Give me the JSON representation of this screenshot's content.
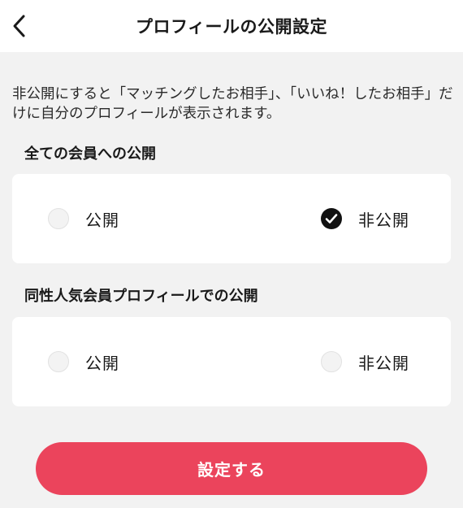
{
  "header": {
    "title": "プロフィールの公開設定",
    "back_icon": "chevron-left-icon"
  },
  "description": "非公開にすると「マッチングしたお相手」、「いいね！したお相手」だけに自分のプロフィールが表示されます。",
  "sections": [
    {
      "title": "全ての会員への公開",
      "options": [
        {
          "label": "公開",
          "selected": false
        },
        {
          "label": "非公開",
          "selected": true
        }
      ]
    },
    {
      "title": "同性人気会員プロフィールでの公開",
      "options": [
        {
          "label": "公開",
          "selected": false
        },
        {
          "label": "非公開",
          "selected": false
        }
      ]
    }
  ],
  "submit_label": "設定する",
  "colors": {
    "accent": "#eb445c",
    "background": "#f2f2f2",
    "card": "#ffffff",
    "selected": "#111111"
  }
}
